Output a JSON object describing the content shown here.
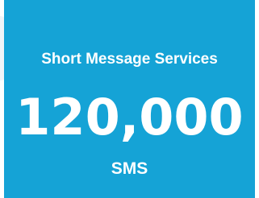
{
  "colors": {
    "card_background": "#15a3d6",
    "text": "#ffffff"
  },
  "card": {
    "title": "Short Message Services",
    "value": "120,000",
    "unit": "SMS"
  }
}
